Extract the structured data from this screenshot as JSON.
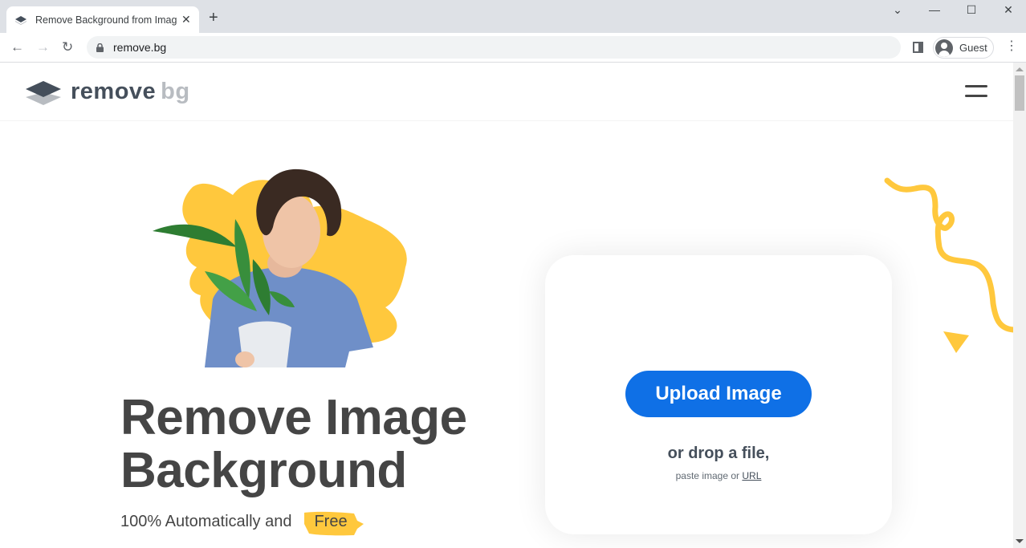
{
  "browser": {
    "tab": {
      "title": "Remove Background from Image",
      "favicon": "removebg-layers-icon"
    },
    "new_tab_label": "+",
    "window_controls": {
      "tab_search": "⌄",
      "minimize": "—",
      "maximize": "☐",
      "close": "✕"
    },
    "nav": {
      "back": "←",
      "forward": "→",
      "reload": "↻"
    },
    "url": "remove.bg",
    "profile_name": "Guest",
    "menu": "⋮"
  },
  "site": {
    "logo": {
      "word1": "remove",
      "word2": "bg"
    },
    "hero": {
      "title_line1": "Remove Image",
      "title_line2": "Background",
      "subtitle": "100% Automatically and",
      "highlight": "Free"
    },
    "upload": {
      "button_label": "Upload Image",
      "drop_text": "or drop a file,",
      "paste_prefix": "paste image or",
      "url_link": "URL"
    },
    "colors": {
      "accent": "#0f70e6",
      "highlight_yellow": "#ffc83d",
      "text_dark": "#454545",
      "logo_dark": "#454f5b",
      "logo_light": "#b8bcc1"
    }
  }
}
